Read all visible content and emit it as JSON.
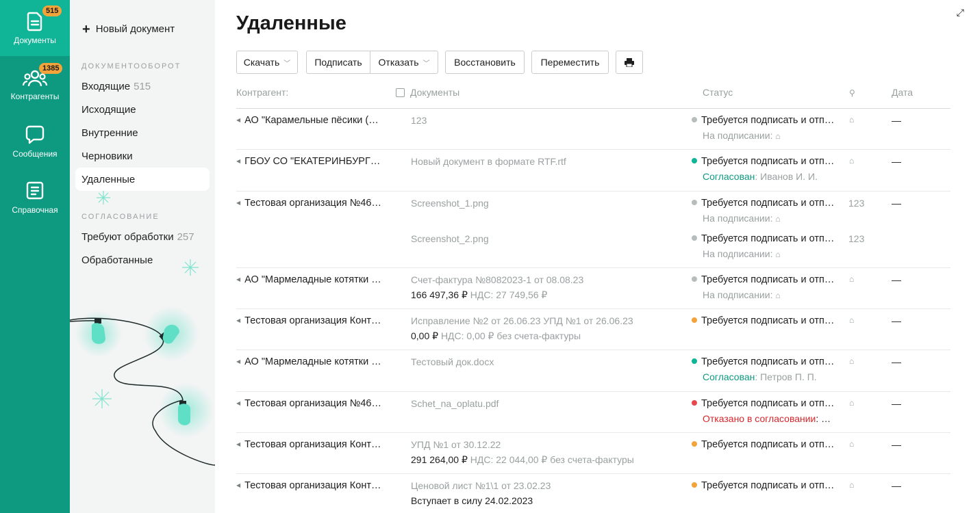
{
  "rail": {
    "items": [
      {
        "label": "Документы",
        "badge": "515",
        "icon": "document-icon"
      },
      {
        "label": "Контрагенты",
        "badge": "1385",
        "icon": "people-icon"
      },
      {
        "label": "Сообщения",
        "icon": "chat-icon"
      },
      {
        "label": "Справочная",
        "icon": "help-book-icon"
      }
    ]
  },
  "sidebar": {
    "new_doc": "Новый документ",
    "section1": "ДОКУМЕНТООБОРОТ",
    "section2": "СОГЛАСОВАНИЕ",
    "items": [
      {
        "label": "Входящие",
        "count": "515"
      },
      {
        "label": "Исходящие"
      },
      {
        "label": "Внутренние"
      },
      {
        "label": "Черновики"
      },
      {
        "label": "Удаленные"
      },
      {
        "label": "Требуют обработки",
        "count": "257"
      },
      {
        "label": "Обработанные"
      }
    ]
  },
  "page": {
    "title": "Удаленные"
  },
  "toolbar": {
    "download": "Скачать",
    "sign": "Подписать",
    "reject": "Отказать",
    "restore": "Восстановить",
    "move": "Переместить"
  },
  "table": {
    "headers": {
      "counterparty": "Контрагент:",
      "documents": "Документы",
      "status": "Статус",
      "date": "Дата"
    },
    "rows": [
      {
        "org": "АО \"Карамельные пёсики (…",
        "docs": [
          {
            "name": "123",
            "status": "Требуется подписать и отп…",
            "dot": "#b7bcbc",
            "sub_label": "На подписании:",
            "sub_kind": "gray",
            "sub_rest": "",
            "tag": "",
            "date": "—"
          }
        ]
      },
      {
        "org": "ГБОУ СО \"ЕКАТЕРИНБУРГ…",
        "docs": [
          {
            "name": "Новый документ в формате RTF.rtf",
            "status": "Требуется подписать и отп…",
            "dot": "#0fb596",
            "sub_label": "Согласован",
            "sub_kind": "green",
            "sub_rest": ": Иванов И. И.",
            "tag": "",
            "date": "—"
          }
        ]
      },
      {
        "org": "Тестовая организация №46…",
        "docs": [
          {
            "name": "Screenshot_1.png",
            "status": "Требуется подписать и отп…",
            "dot": "#b7bcbc",
            "sub_label": "На подписании:",
            "sub_kind": "gray",
            "sub_rest": "",
            "tag": "123",
            "date": "—"
          },
          {
            "name": "Screenshot_2.png",
            "status": "Требуется подписать и отп…",
            "dot": "#b7bcbc",
            "sub_label": "На подписании:",
            "sub_kind": "gray",
            "sub_rest": "",
            "tag": "123",
            "date": ""
          }
        ]
      },
      {
        "org": "АО \"Мармеладные котятки …",
        "docs": [
          {
            "name": "Счет-фактура №8082023-1 от 08.08.23",
            "amount": "166 497,36 ₽",
            "amount_rest": "НДС: 27 749,56 ₽",
            "status": "Требуется подписать и отп…",
            "dot": "#b7bcbc",
            "sub_label": "На подписании:",
            "sub_kind": "gray",
            "sub_rest": "",
            "tag": "",
            "date": "—"
          }
        ]
      },
      {
        "org": "Тестовая организация Конт…",
        "docs": [
          {
            "name": "Исправление №2 от 26.06.23 УПД №1 от 26.06.23",
            "amount": "0,00 ₽",
            "amount_rest": "НДС: 0,00 ₽  без счета-фактуры",
            "status": "Требуется подписать и отп…",
            "dot": "#f2a33a",
            "sub_label": "",
            "sub_kind": "",
            "sub_rest": "",
            "tag": "",
            "date": "—"
          }
        ]
      },
      {
        "org": "АО \"Мармеладные котятки …",
        "docs": [
          {
            "name": "Тестовый док.docx",
            "status": "Требуется подписать и отп…",
            "dot": "#0fb596",
            "sub_label": "Согласован",
            "sub_kind": "green",
            "sub_rest": ": Петров П. П.",
            "tag": "",
            "date": "—"
          }
        ]
      },
      {
        "org": "Тестовая организация №46…",
        "docs": [
          {
            "name": "Schet_na_oplatu.pdf",
            "status": "Требуется подписать и отп…",
            "dot": "#e5484d",
            "sub_label": "Отказано в согласовании",
            "sub_kind": "red",
            "sub_rest_dark": ": …",
            "tag": "",
            "date": "—"
          }
        ]
      },
      {
        "org": "Тестовая организация Конт…",
        "docs": [
          {
            "name": "УПД №1 от 30.12.22",
            "amount": "291 264,00 ₽",
            "amount_rest": "НДС: 22 044,00 ₽  без счета-фактуры",
            "status": "Требуется подписать и отп…",
            "dot": "#f2a33a",
            "sub_label": "",
            "sub_kind": "",
            "sub_rest": "",
            "tag": "",
            "date": "—"
          }
        ]
      },
      {
        "org": "Тестовая организация Конт…",
        "docs": [
          {
            "name": "Ценовой лист №1\\1 от 23.02.23",
            "amount": "Вступает в силу 24.02.2023",
            "amount_rest": "",
            "status": "Требуется подписать и отп…",
            "dot": "#f2a33a",
            "sub_label": "",
            "sub_kind": "",
            "sub_rest": "",
            "tag": "",
            "date": "—"
          }
        ]
      }
    ]
  },
  "colors": {
    "rail": "#0d9a80",
    "rail_active": "#0fb596",
    "badge": "#f2a33a",
    "green": "#0d9a80",
    "red": "#d7262b",
    "orange": "#f2a33a"
  }
}
